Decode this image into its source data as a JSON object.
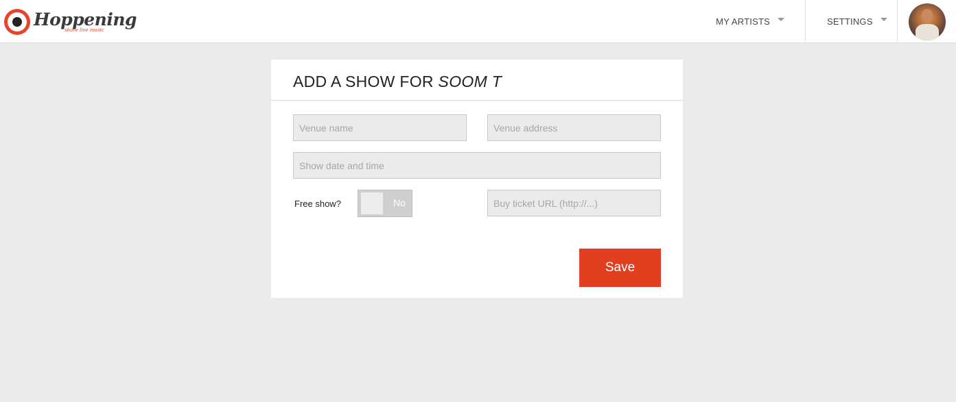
{
  "app": {
    "name": "Hoppening",
    "tagline": "share live music",
    "brand_color": "#e8442b"
  },
  "nav": {
    "my_artists": "MY ARTISTS",
    "settings": "SETTINGS",
    "avatar_icon": "user-avatar"
  },
  "form": {
    "title_prefix": "ADD A SHOW FOR",
    "artist_name": "SOOM T",
    "venue_name": {
      "value": "",
      "placeholder": "Venue name"
    },
    "venue_address": {
      "value": "",
      "placeholder": "Venue address"
    },
    "show_datetime": {
      "value": "",
      "placeholder": "Show date and time"
    },
    "free_show_label": "Free show?",
    "free_show_toggle": "No",
    "ticket_url": {
      "value": "",
      "placeholder": "Buy ticket URL (http://...)"
    },
    "save_label": "Save",
    "save_color": "#e03f20"
  }
}
